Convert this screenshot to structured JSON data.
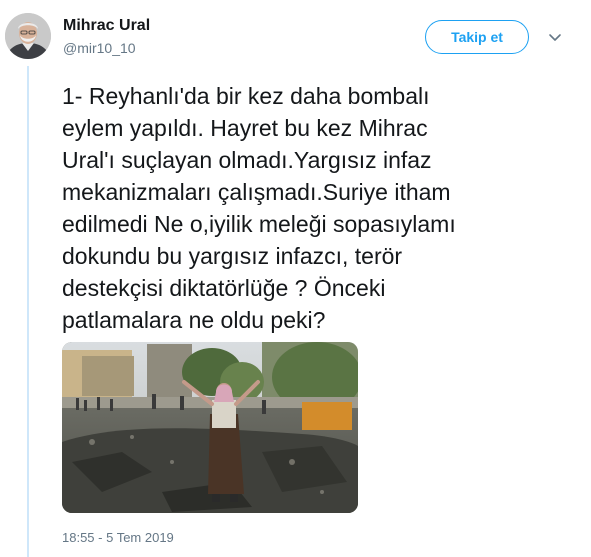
{
  "author": {
    "display_name": "Mihrac Ural",
    "handle": "@mir10_10",
    "avatar_icon": "user-avatar"
  },
  "header": {
    "follow_label": "Takip et",
    "menu_icon": "chevron-down-icon"
  },
  "tweet": {
    "text": "1- Reyhanlı'da bir kez daha bombalı\neylem yapıldı. Hayret bu kez Mihrac\nUral'ı suçlayan olmadı.Yargısız infaz\nmekanizmaları çalışmadı.Suriye itham\nedilmedi Ne o,iyilik meleği sopasıylamı\ndokundu bu yargısız infazcı, terör\ndestekçisi diktatörlüğe ? Önceki\npatlamalara ne oldu peki?",
    "timestamp": "18:55 - 5 Tem 2019"
  },
  "colors": {
    "accent": "#1da1f2",
    "text": "#14171a",
    "muted": "#657786",
    "thread_line": "#cfe7fa"
  }
}
